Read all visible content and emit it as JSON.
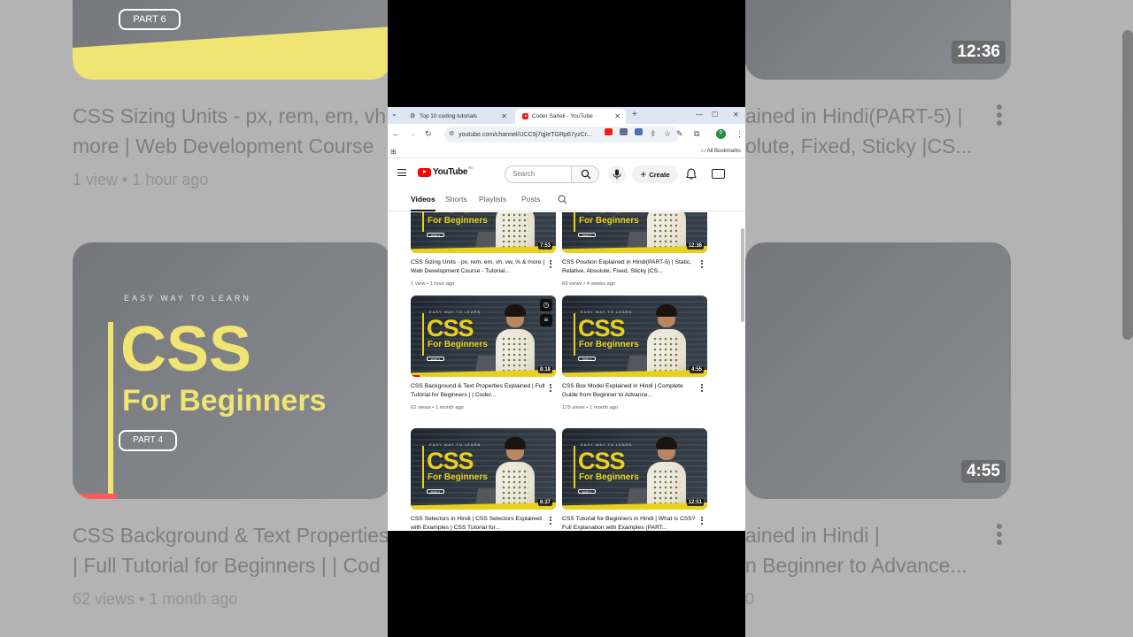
{
  "browser": {
    "tabs": [
      {
        "title": "Top 10 coding tutorials",
        "active": false
      },
      {
        "title": "Coder Saheli - YouTube",
        "active": true
      }
    ],
    "new_tab": "+",
    "url": "youtube.com/channel/UCC9j7qjIeTGRp67yzCr...",
    "bookmarks_label": "All Bookmarks",
    "profile_initial": "P"
  },
  "youtube": {
    "logo_text": "YouTube",
    "country_code": "IN",
    "search_placeholder": "Search",
    "create_label": "Create",
    "channel_tabs": [
      "Videos",
      "Shorts",
      "Playlists",
      "Posts"
    ],
    "videos": [
      {
        "title": "CSS Sizing Units - px, rem, em, vh, vw, % & more | Web Development Course - Tutorial...",
        "meta": "1 view • 1 hour ago",
        "duration": "7:53",
        "part": "PART 6"
      },
      {
        "title": "CSS Position Explained in Hindi(PART-5) | Static, Relative, Absolute, Fixed, Sticky |CS...",
        "meta": "69 views • 4 weeks ago",
        "duration": "12:36",
        "part": "PART 5"
      },
      {
        "title": "CSS Background & Text Properties Explained | Full Tutorial for Beginners | | Coder...",
        "meta": "62 views • 1 month ago",
        "duration": "8:18",
        "part": "PART 4"
      },
      {
        "title": "CSS Box Model Explained in Hindi | Complete Guide from Beginner to Advance...",
        "meta": "175 views • 1 month ago",
        "duration": "4:55",
        "part": "PART 3"
      },
      {
        "title": "CSS Selectors in Hindi | CSS Selectors Explained with Examples | CSS Tutorial for...",
        "meta": "",
        "duration": "6:37",
        "part": "PART 2"
      },
      {
        "title": "CSS Tutorial for Beginners in Hindi | What is CSS? Full Explanation with Examples (PART...",
        "meta": "",
        "duration": "12:51",
        "part": "PART 1"
      }
    ],
    "thumb_text": {
      "easy": "EASY WAY TO LEARN",
      "css": "CSS",
      "for": "For Beginners"
    }
  },
  "background": {
    "left_title_1": "CSS Sizing Units - px, rem, em, vh",
    "left_title_2": "more | Web Development Course",
    "left_meta_1": "1 view • 1 hour ago",
    "left_title_3": "CSS Background & Text Properties",
    "left_title_4": "| Full Tutorial for Beginners | | Cod",
    "left_meta_2": "62 views • 1 month ago",
    "right_title_1": "ained in Hindi(PART-5) |",
    "right_title_2": "olute, Fixed, Sticky |CS...",
    "right_title_3": "ained in Hindi |",
    "right_title_4": "n Beginner to Advance...",
    "right_meta_2": "0",
    "dur_top": "12:36",
    "dur_bottom": "4:55",
    "part_label": "PART 4",
    "part_label_top": "PART 6",
    "css_text": "CSS",
    "for_text": "For Beginners",
    "easy_text": "EASY WAY TO LEARN"
  }
}
